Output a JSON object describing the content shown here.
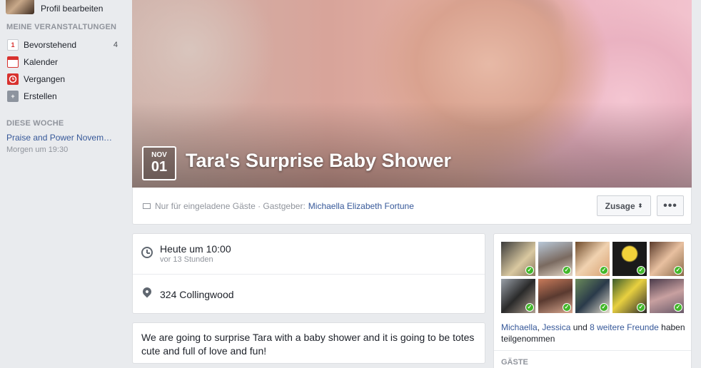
{
  "sidebar": {
    "profile_link": "Profil bearbeiten",
    "my_events_heading": "MEINE VERANSTALTUNGEN",
    "items": [
      {
        "label": "Bevorstehend",
        "count": "4",
        "icon": "calendar-day-icon",
        "icon_text": "1",
        "icon_color": "#ffffff"
      },
      {
        "label": "Kalender",
        "count": "",
        "icon": "calendar-grid-icon",
        "icon_text": "",
        "icon_color": "#f0c8c8"
      },
      {
        "label": "Vergangen",
        "count": "",
        "icon": "clock-past-icon",
        "icon_text": "",
        "icon_color": "#d8322f"
      },
      {
        "label": "Erstellen",
        "count": "",
        "icon": "plus-create-icon",
        "icon_text": "+",
        "icon_color": "#8d949e"
      }
    ],
    "this_week_heading": "DIESE WOCHE",
    "week_event": {
      "title": "Praise and Power Novem…",
      "time": "Morgen um 19:30"
    }
  },
  "event": {
    "month": "NOV",
    "day": "01",
    "title": "Tara's Surprise Baby Shower",
    "privacy": "Nur für eingeladene Gäste · Gastgeber:",
    "host": "Michaella Elizabeth Fortune",
    "rsvp_label": "Zusage",
    "more_label": "•••",
    "when_main": "Heute  um 10:00",
    "when_sub": "vor 13 Stunden",
    "where": "324 Collingwood",
    "description": "We are going to surprise Tara with a baby shower and it is going to be totes cute and full of love and fun!"
  },
  "guests": {
    "names_part1": "Michaella",
    "sep": ", ",
    "names_part2": "Jessica",
    "and": " und ",
    "friends_link": "8 weitere Freunde",
    "suffix": " haben teilgenommen",
    "heading": "GÄSTE"
  },
  "colors": {
    "link": "#365899",
    "accent_check": "#42b72a",
    "background": "#e9ebee"
  }
}
